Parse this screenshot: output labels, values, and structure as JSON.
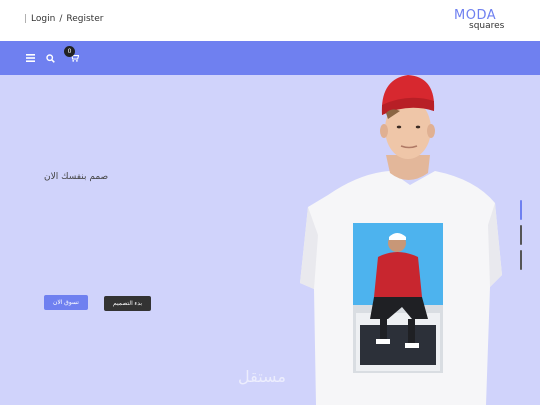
{
  "header": {
    "login_label": "Login",
    "separator": "/",
    "register_label": "Register",
    "logo_top": "MODA",
    "logo_bottom": "squares"
  },
  "nav": {
    "cart_count": "0",
    "icons": [
      "menu-icon",
      "search-icon",
      "cart-icon"
    ]
  },
  "hero": {
    "title": "صمم بنفسك الان",
    "shop_button": "تسوق الان",
    "design_button": "بدء التصميم",
    "slides": {
      "count": 3,
      "active": 1
    },
    "watermark": "مستقل"
  },
  "colors": {
    "accent": "#6f80f0",
    "hero_bg": "#d0d3fb",
    "dark": "#333333"
  }
}
